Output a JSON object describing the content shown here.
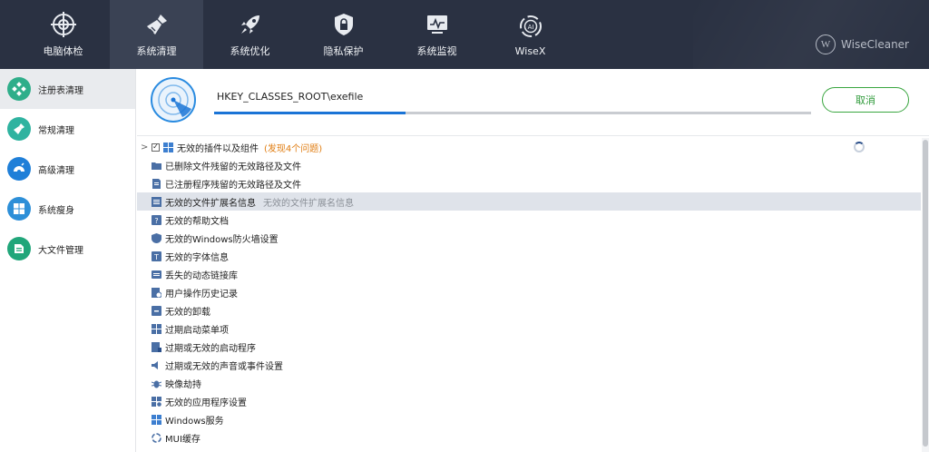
{
  "nav": {
    "items": [
      {
        "label": "电脑体检",
        "icon": "target-icon"
      },
      {
        "label": "系统清理",
        "icon": "broom-icon",
        "active": true
      },
      {
        "label": "系统优化",
        "icon": "rocket-icon"
      },
      {
        "label": "隐私保护",
        "icon": "shield-lock-icon"
      },
      {
        "label": "系统监视",
        "icon": "monitor-icon"
      },
      {
        "label": "WiseX",
        "icon": "ai-icon"
      }
    ],
    "brand": "WiseCleaner",
    "brand_logo": "W"
  },
  "sidebar": {
    "items": [
      {
        "label": "注册表清理",
        "icon": "registry-icon",
        "color": "#2fae8a",
        "active": true
      },
      {
        "label": "常规清理",
        "icon": "broom-icon",
        "color": "#2fb3a0"
      },
      {
        "label": "高级清理",
        "icon": "advanced-clean-icon",
        "color": "#1f7fd8"
      },
      {
        "label": "系统瘦身",
        "icon": "windows-icon",
        "color": "#2d8fd8"
      },
      {
        "label": "大文件管理",
        "icon": "file-icon",
        "color": "#21a67a"
      }
    ]
  },
  "scan": {
    "path": "HKEY_CLASSES_ROOT\\exefile",
    "progress": 0.32,
    "cancel_label": "取消"
  },
  "list": {
    "parent": {
      "label": "无效的插件以及组件",
      "found": "(发现4个问题)",
      "checked": true
    },
    "items": [
      {
        "label": "已删除文件残留的无效路径及文件",
        "icon": "folder-icon"
      },
      {
        "label": "已注册程序残留的无效路径及文件",
        "icon": "document-icon"
      },
      {
        "label": "无效的文件扩展名信息",
        "desc": "无效的文件扩展名信息",
        "icon": "extension-icon",
        "selected": true
      },
      {
        "label": "无效的帮助文档",
        "icon": "help-doc-icon"
      },
      {
        "label": "无效的Windows防火墙设置",
        "icon": "firewall-icon"
      },
      {
        "label": "无效的字体信息",
        "icon": "font-icon"
      },
      {
        "label": "丢失的动态链接库",
        "icon": "dll-icon"
      },
      {
        "label": "用户操作历史记录",
        "icon": "history-icon"
      },
      {
        "label": "无效的卸载",
        "icon": "uninstall-icon"
      },
      {
        "label": "过期启动菜单项",
        "icon": "start-menu-icon"
      },
      {
        "label": "过期或无效的启动程序",
        "icon": "startup-icon"
      },
      {
        "label": "过期或无效的声音或事件设置",
        "icon": "sound-icon"
      },
      {
        "label": "映像劫持",
        "icon": "bug-icon"
      },
      {
        "label": "无效的应用程序设置",
        "icon": "app-settings-icon"
      },
      {
        "label": "Windows服务",
        "icon": "windows-icon"
      },
      {
        "label": "MUI缓存",
        "icon": "mui-cache-icon"
      }
    ]
  },
  "colors": {
    "topbar": "#2a3142",
    "accent_green": "#3aa640",
    "progress_blue": "#1a74d6",
    "found_orange": "#e07d12"
  }
}
